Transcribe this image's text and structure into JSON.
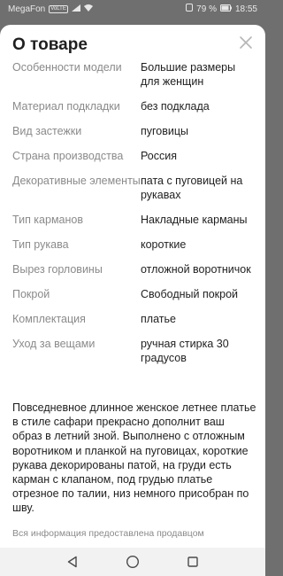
{
  "status_bar": {
    "carrier": "MegaFon",
    "volte": "VoLTE",
    "battery": "79 %",
    "time": "18:55"
  },
  "sheet": {
    "title": "О товаре"
  },
  "specs": [
    {
      "label": "Особенности модели",
      "value": "Большие размеры для женщин"
    },
    {
      "label": "Материал подкладки",
      "value": "без подклада"
    },
    {
      "label": "Вид застежки",
      "value": "пуговицы"
    },
    {
      "label": "Страна производства",
      "value": "Россия"
    },
    {
      "label": "Декоративные элементы",
      "value": "пата с пуговицей на рукавах"
    },
    {
      "label": "Тип карманов",
      "value": "Накладные карманы"
    },
    {
      "label": "Тип рукава",
      "value": "короткие"
    },
    {
      "label": "Вырез горловины",
      "value": "отложной воротничок"
    },
    {
      "label": "Покрой",
      "value": "Свободный покрой"
    },
    {
      "label": "Комплектация",
      "value": "платье"
    },
    {
      "label": "Уход за вещами",
      "value": "ручная стирка 30 градусов"
    }
  ],
  "description": "Повседневное длинное женское летнее платье в стиле сафари прекрасно дополнит ваш образ в летний зной. Выполнено с отложным воротником и планкой на пуговицах, короткие рукава декорированы патой, на груди есть карман с клапаном, под грудью платье отрезное по талии, низ немного присобран по шву.",
  "disclaimer": "Вся информация предоставлена продавцом",
  "icons": {
    "close": "close-icon",
    "back": "back-triangle-icon",
    "home": "home-circle-icon",
    "recents": "recents-square-icon"
  }
}
